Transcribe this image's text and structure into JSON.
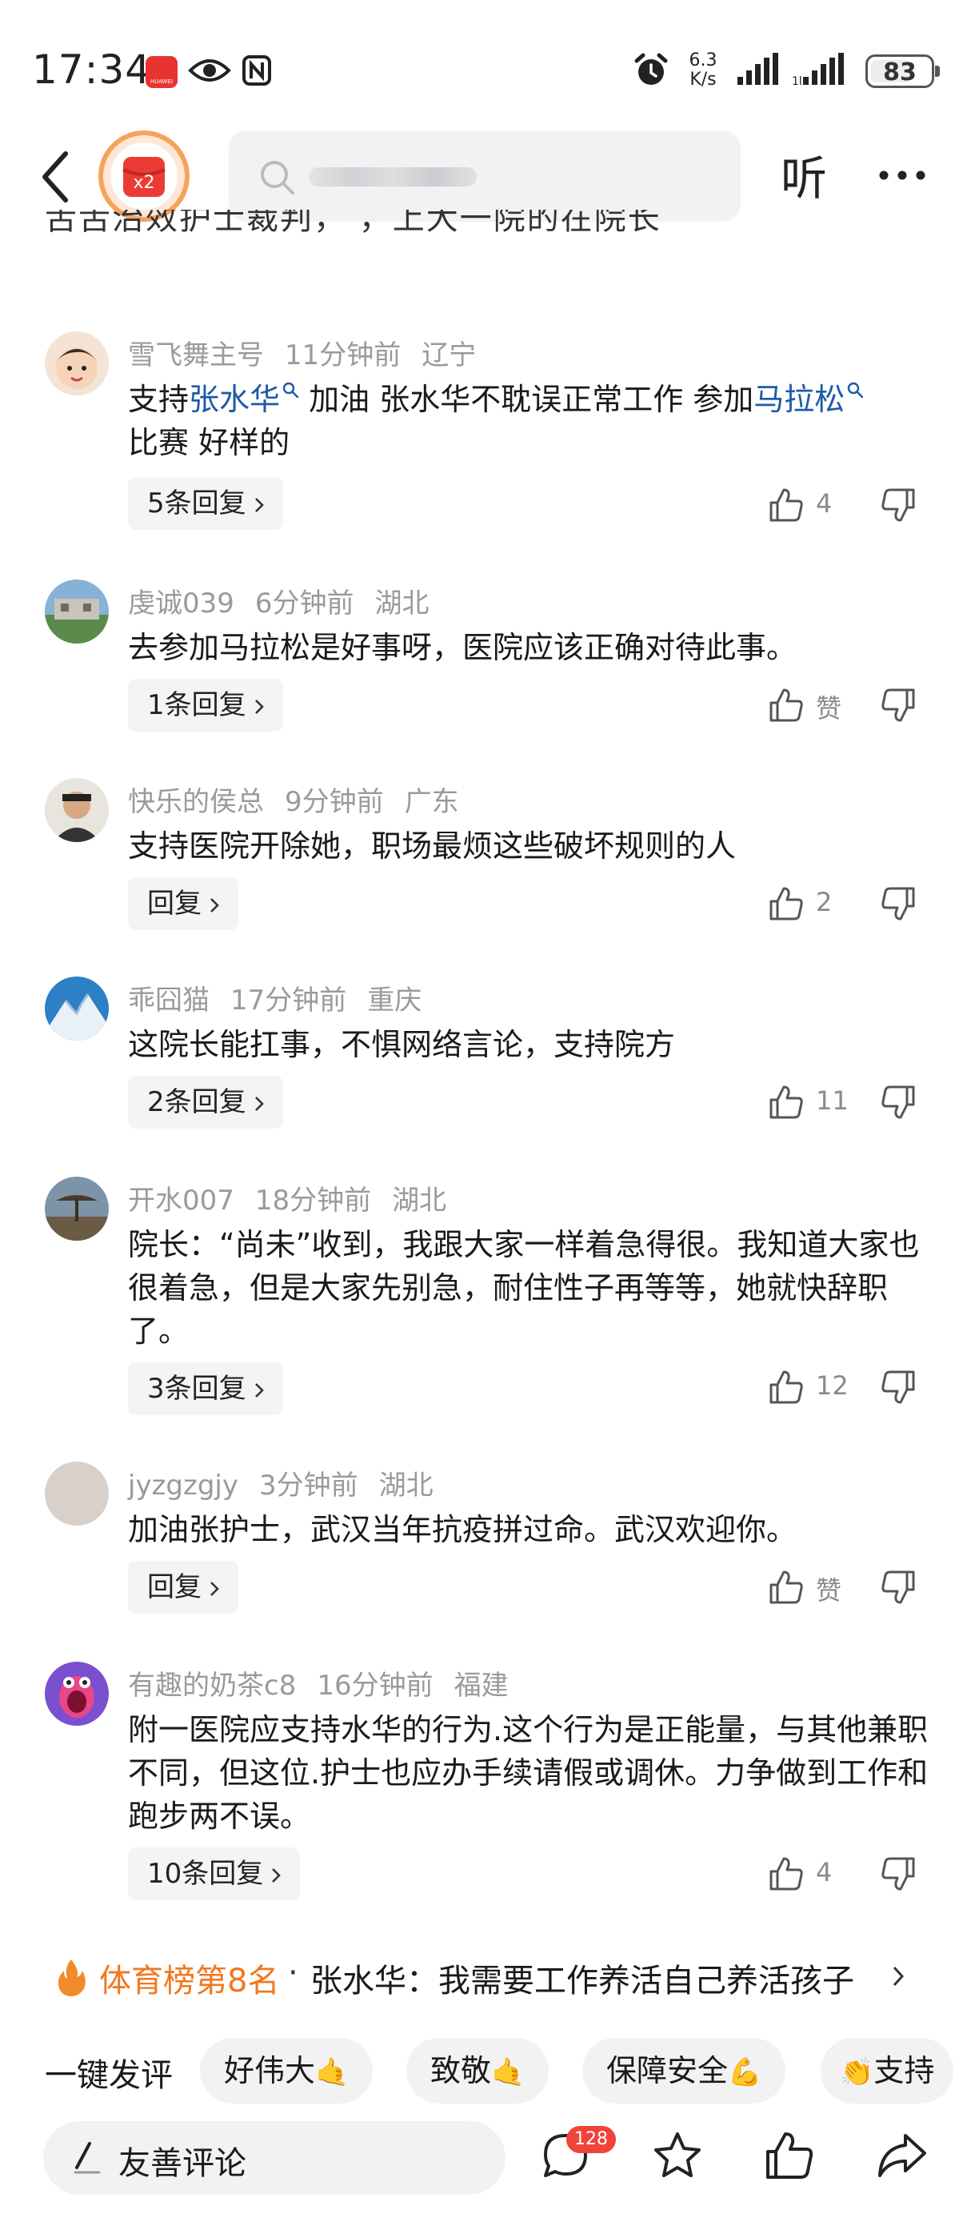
{
  "status_bar": {
    "time": "17:34",
    "huawei_label": "HUAWEI",
    "net_speed_value": "6.3",
    "net_speed_unit": "K/s",
    "battery": "83"
  },
  "nav": {
    "reward_label": "x2",
    "listen_label": "听"
  },
  "cutoff_text": "舌舌治效护士裁判，   ，上大一院的在院长",
  "comments": [
    {
      "user": "雪飞舞主号",
      "time": "11分钟前",
      "location": "辽宁",
      "text_parts": [
        "支持",
        "张水华",
        " 加油 张水华不耽误正常工作 参加",
        "马拉松",
        "比赛 好样的"
      ],
      "reply_label": "5条回复",
      "likes": "4"
    },
    {
      "user": "虔诚039",
      "time": "6分钟前",
      "location": "湖北",
      "text": "去参加马拉松是好事呀，医院应该正确对待此事。",
      "reply_label": "1条回复",
      "likes": "赞"
    },
    {
      "user": "快乐的侯总",
      "time": "9分钟前",
      "location": "广东",
      "text": "支持医院开除她，职场最烦这些破坏规则的人",
      "reply_label": "回复",
      "likes": "2"
    },
    {
      "user": "乖囧猫",
      "time": "17分钟前",
      "location": "重庆",
      "text": "这院长能扛事，不惧网络言论，支持院方",
      "reply_label": "2条回复",
      "likes": "11"
    },
    {
      "user": "开水007",
      "time": "18分钟前",
      "location": "湖北",
      "text": "院长：“尚未”收到，我跟大家一样着急得很。我知道大家也很着急，但是大家先别急，耐住性子再等等，她就快辞职了。",
      "reply_label": "3条回复",
      "likes": "12"
    },
    {
      "user": "jyzgzgjy",
      "time": "3分钟前",
      "location": "湖北",
      "text": "加油张护士，武汉当年抗疫拼过命。武汉欢迎你。",
      "reply_label": "回复",
      "likes": "赞"
    },
    {
      "user": "有趣的奶茶c8",
      "time": "16分钟前",
      "location": "福建",
      "text": "附一医院应支持水华的行为.这个行为是正能量，与其他兼职不同，但这位.护士也应办手续请假或调休。力争做到工作和跑步两不误。",
      "reply_label": "10条回复",
      "likes": "4"
    }
  ],
  "hot_bar": {
    "rank": "体育榜第8名",
    "separator": "·",
    "title": "张水华：我需要工作养活自己养活孩子"
  },
  "quick_comment": {
    "label": "一键发评",
    "chips": [
      {
        "text": "好伟大",
        "emoji": "🤙"
      },
      {
        "text": "致敬",
        "emoji": "🤙"
      },
      {
        "text": "保障安全",
        "emoji": "💪"
      },
      {
        "text": "支持",
        "emoji": "👏"
      }
    ]
  },
  "bottom_bar": {
    "placeholder": "友善评论",
    "comment_count": "128"
  },
  "colors": {
    "link": "#1e5aa8",
    "hot_orange": "#f0781e",
    "badge_red": "#f0443a"
  }
}
